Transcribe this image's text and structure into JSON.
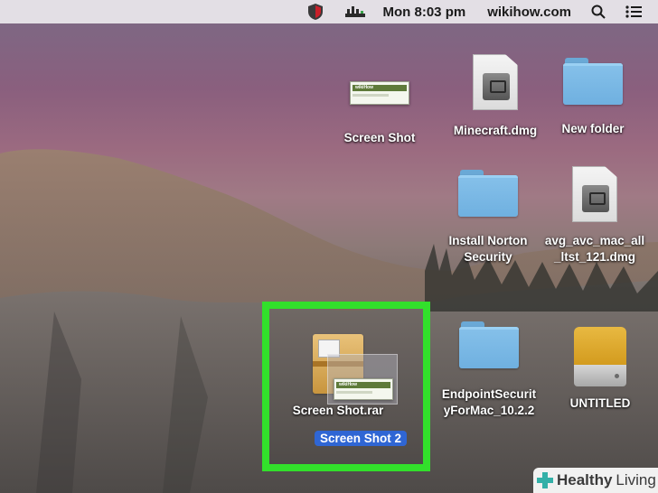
{
  "menubar": {
    "clock": "Mon 8:03 pm",
    "site": "wikihow.com",
    "icons": [
      "shield-icon",
      "network-icon",
      "spotlight-search-icon",
      "notification-list-icon"
    ]
  },
  "desktop_items": [
    {
      "label": "Screen Shot",
      "kind": "screenshot-file",
      "thumb_text": "wikiHow"
    },
    {
      "label": "Minecraft.dmg",
      "kind": "disk-image"
    },
    {
      "label": "New folder",
      "kind": "folder"
    },
    {
      "label": "Install Norton\nSecurity",
      "kind": "folder"
    },
    {
      "label": "avg_avc_mac_all\n_ltst_121.dmg",
      "kind": "disk-image"
    },
    {
      "label": "EndpointSecurit\nyForMac_10.2.2",
      "kind": "folder"
    },
    {
      "label": "UNTITLED",
      "kind": "external-drive"
    },
    {
      "label": "Screen Shot.rar",
      "kind": "archive"
    }
  ],
  "drag": {
    "label": "Screen Shot 2",
    "thumb_text": "wikiHow"
  },
  "colors": {
    "highlight": "#32e02b",
    "selection": "#2f66d4",
    "folder": "#79b7e4"
  },
  "watermark": {
    "brand_bold": "Healthy",
    "brand_light": "Living"
  }
}
